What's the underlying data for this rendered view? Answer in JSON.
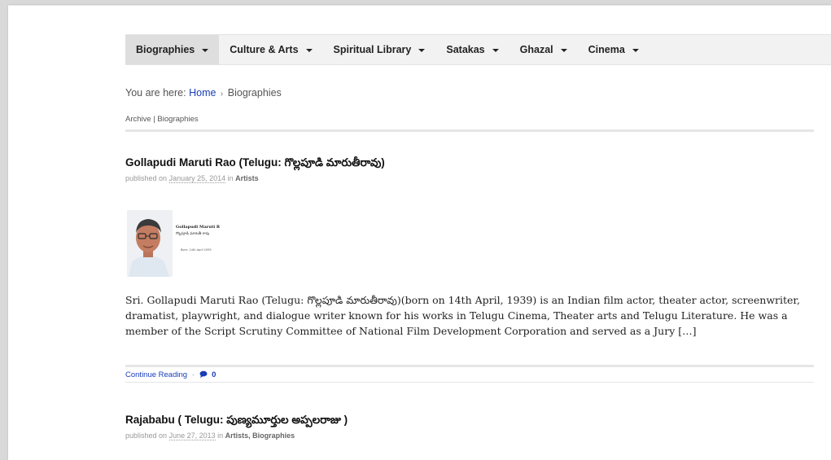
{
  "nav": {
    "items": [
      {
        "label": "Biographies",
        "active": true
      },
      {
        "label": "Culture & Arts"
      },
      {
        "label": "Spiritual Library"
      },
      {
        "label": "Satakas"
      },
      {
        "label": "Ghazal"
      },
      {
        "label": "Cinema"
      }
    ]
  },
  "breadcrumb": {
    "prefix": "You are here:",
    "home": "Home",
    "separator": "›",
    "current": "Biographies"
  },
  "archive": {
    "label": "Archive | Biographies"
  },
  "posts": [
    {
      "title": "Gollapudi Maruti Rao (Telugu: గొల్లపూడి మారుతీరావు)",
      "published_prefix": "published on",
      "date": "January 25, 2014",
      "in_word": "in",
      "categories": "Artists",
      "thumbnail": {
        "name_line1": "Gollapudi Maruti R",
        "name_line2": "గొల్లపూడి మారుతీ రావు",
        "born_line": "Born: 14th April 1939"
      },
      "excerpt": "Sri. Gollapudi Maruti Rao (Telugu: గొల్లపూడి మారుతీరావు)(born on 14th April, 1939) is an Indian film actor, theater actor, screenwriter, dramatist, playwright, and dialogue writer known for his works in Telugu Cinema, Theater arts and Telugu Literature. He was a member of the Script Scrutiny Committee of National Film Development Corporation and served as a Jury […]",
      "continue_label": "Continue Reading",
      "separator": "·",
      "comment_count": "0"
    },
    {
      "title": "Rajababu ( Telugu: పుణ్యమూర్తుల అప్పలరాజు )",
      "published_prefix": "published on",
      "date": "June 27, 2013",
      "in_word": "in",
      "categories": "Artists, Biographies"
    }
  ],
  "colors": {
    "link": "#1a3db8",
    "nav_bg": "#f2f2f2",
    "nav_active_bg": "#dedede",
    "comment_icon": "#1a3db8"
  }
}
